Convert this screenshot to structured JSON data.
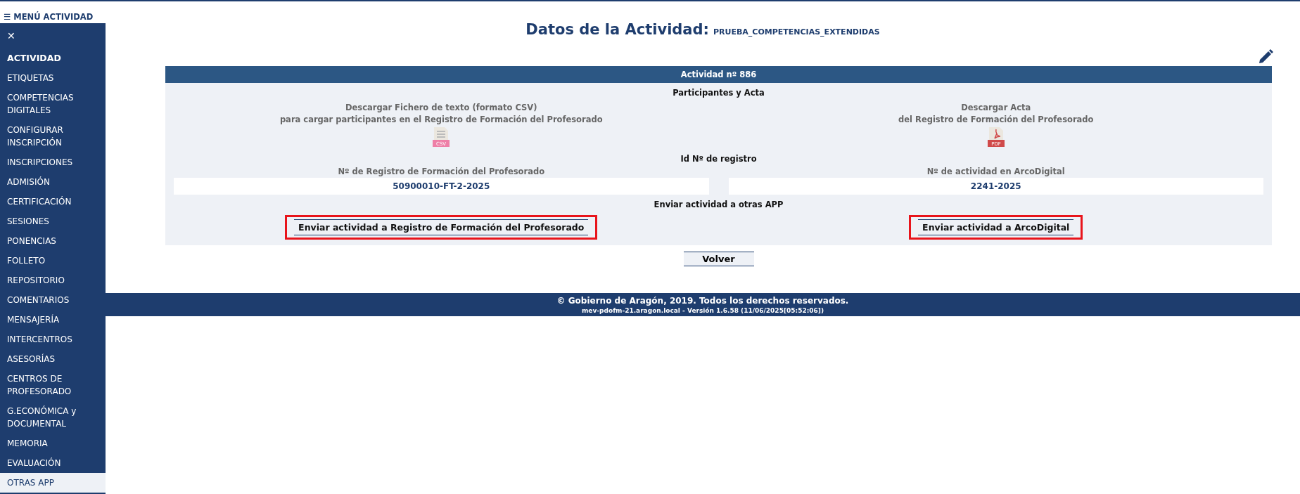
{
  "menu": {
    "title": "MENÚ ACTIVIDAD",
    "menu_icon": "☰",
    "close": "✕",
    "items": [
      {
        "label": "ACTIVIDAD",
        "kind": "heading",
        "selected": false
      },
      {
        "label": "ETIQUETAS",
        "kind": "link",
        "selected": false
      },
      {
        "label": "COMPETENCIAS DIGITALES",
        "kind": "link",
        "selected": false
      },
      {
        "label": "CONFIGURAR INSCRIPCIÓN",
        "kind": "link",
        "selected": false
      },
      {
        "label": "INSCRIPCIONES",
        "kind": "link",
        "selected": false
      },
      {
        "label": "ADMISIÓN",
        "kind": "link",
        "selected": false
      },
      {
        "label": "CERTIFICACIÓN",
        "kind": "link",
        "selected": false
      },
      {
        "label": "SESIONES",
        "kind": "link",
        "selected": false
      },
      {
        "label": "PONENCIAS",
        "kind": "link",
        "selected": false
      },
      {
        "label": "FOLLETO",
        "kind": "link",
        "selected": false
      },
      {
        "label": "REPOSITORIO",
        "kind": "link",
        "selected": false
      },
      {
        "label": "COMENTARIOS",
        "kind": "link",
        "selected": false
      },
      {
        "label": "MENSAJERÍA",
        "kind": "link",
        "selected": false
      },
      {
        "label": "INTERCENTROS",
        "kind": "link",
        "selected": false
      },
      {
        "label": "ASESORÍAS",
        "kind": "link",
        "selected": false
      },
      {
        "label": "CENTROS DE PROFESORADO",
        "kind": "link",
        "selected": false
      },
      {
        "label": "G.ECONÓMICA y DOCUMENTAL",
        "kind": "link",
        "selected": false
      },
      {
        "label": "MEMORIA",
        "kind": "link",
        "selected": false
      },
      {
        "label": "EVALUACIÓN",
        "kind": "link",
        "selected": false
      },
      {
        "label": "OTRAS APP",
        "kind": "link",
        "selected": true
      }
    ]
  },
  "page": {
    "title": "Datos de la Actividad:",
    "activity_name": "PRUEBA_COMPETENCIAS_EXTENDIDAS"
  },
  "panel": {
    "header": "Actividad nº 886",
    "section_1": "Participantes y Acta",
    "downloads": [
      {
        "lines": [
          "Descargar Fichero de texto (formato CSV)",
          "para cargar participantes en el Registro de Formación del Profesorado"
        ],
        "kind": "csv",
        "badge": "CSV"
      },
      {
        "lines": [
          "Descargar Acta",
          "del Registro de Formación del Profesorado"
        ],
        "kind": "pdf",
        "badge": "PDF"
      }
    ],
    "section_2": "Id Nº de registro",
    "fields": [
      {
        "label": "Nº de Registro de Formación del Profesorado",
        "value": "50900010-FT-2-2025"
      },
      {
        "label": "Nº de actividad en ArcoDigital",
        "value": "2241-2025"
      }
    ],
    "section_3": "Enviar actividad a otras APP",
    "buttons": [
      {
        "label": "Enviar actividad a Registro de Formación del Profesorado",
        "highlighted": true
      },
      {
        "label": "Enviar actividad a ArcoDigital",
        "highlighted": true
      }
    ]
  },
  "back_button": "Volver",
  "footer": {
    "copyright": "© Gobierno de Aragón, 2019. Todos los derechos reservados.",
    "version": "mev-pdofm-21.aragon.local - Versión 1.6.58 (11/06/2025[05:52:06])"
  }
}
